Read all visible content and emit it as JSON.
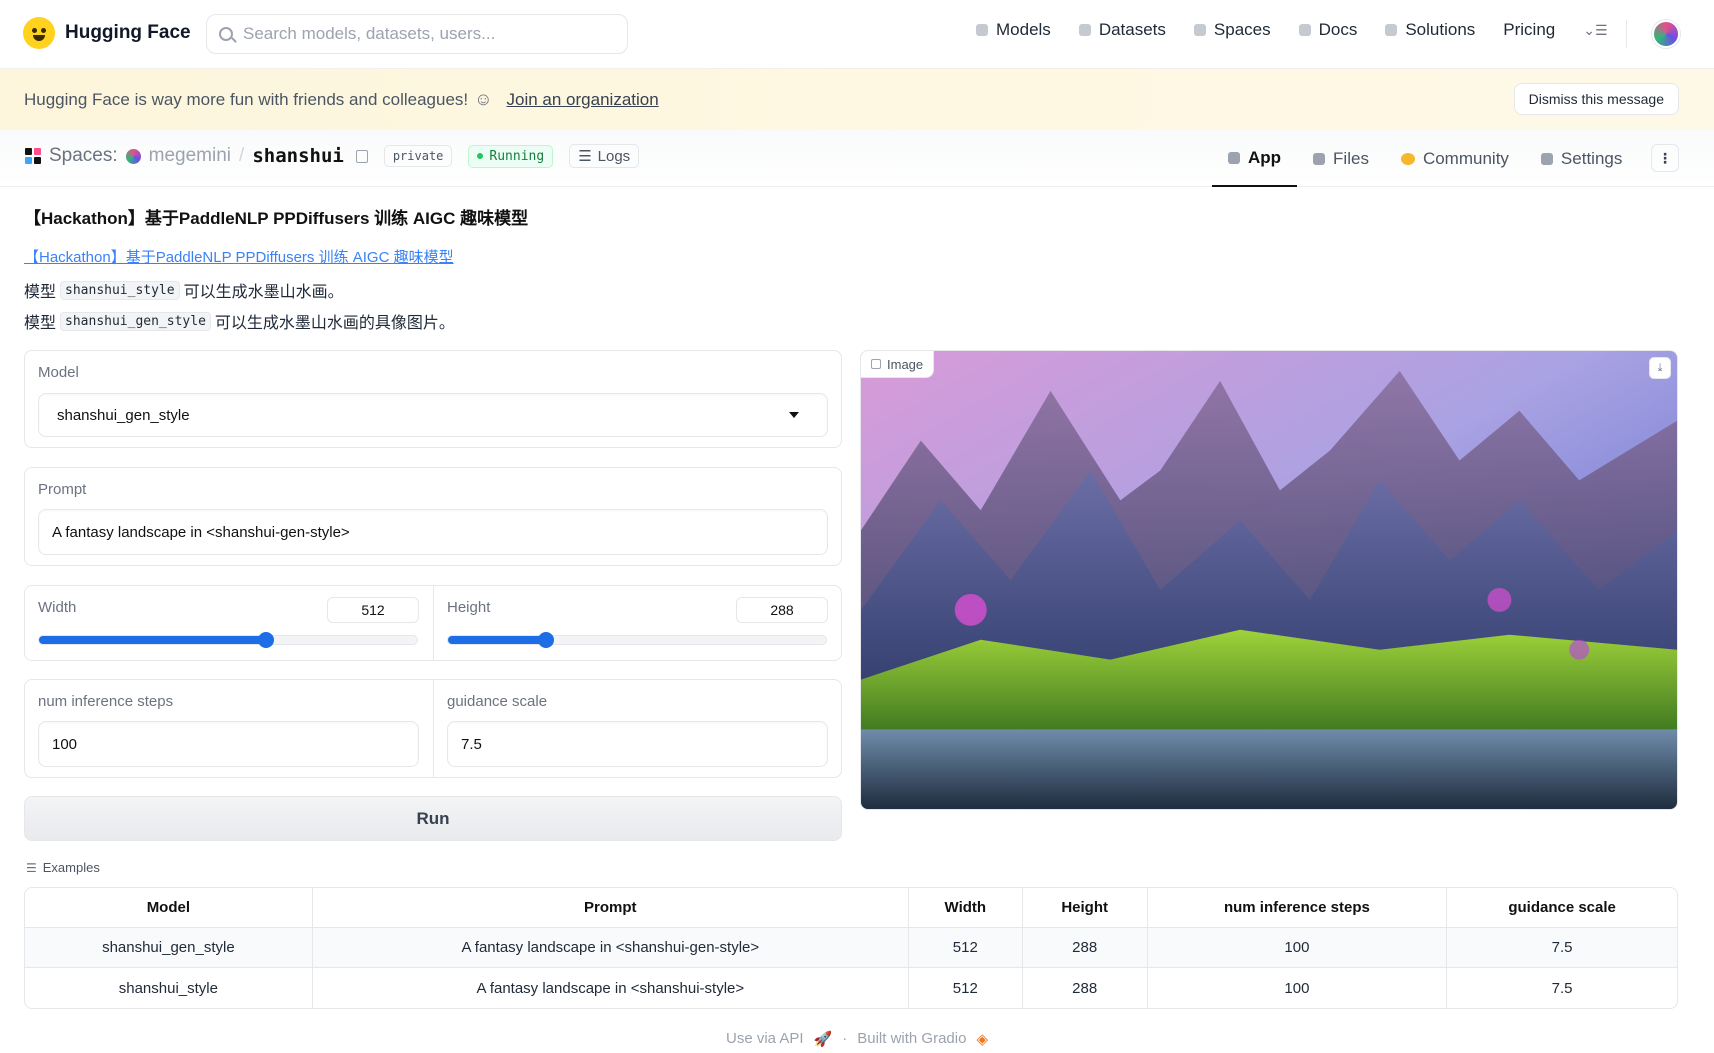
{
  "brand": {
    "name": "Hugging Face"
  },
  "search": {
    "placeholder": "Search models, datasets, users..."
  },
  "nav": {
    "items": [
      {
        "label": "Models",
        "icon": "cube-icon"
      },
      {
        "label": "Datasets",
        "icon": "database-icon"
      },
      {
        "label": "Spaces",
        "icon": "grid-icon"
      },
      {
        "label": "Docs",
        "icon": "book-icon"
      },
      {
        "label": "Solutions",
        "icon": "briefcase-icon"
      },
      {
        "label": "Pricing"
      }
    ]
  },
  "banner": {
    "text": "Hugging Face is way more fun with friends and colleagues!",
    "icon": "hugging-icon",
    "link": "Join an organization",
    "dismiss": "Dismiss this message"
  },
  "space": {
    "section": "Spaces:",
    "owner": "megemini",
    "separator": "/",
    "repo": "shanshui",
    "visibility": "private",
    "status": "Running",
    "logs": "Logs",
    "tabs": [
      "App",
      "Files",
      "Community",
      "Settings"
    ]
  },
  "app": {
    "title": "【Hackathon】基于PaddleNLP PPDiffusers 训练 AIGC 趣味模型",
    "link": "【Hackathon】基于PaddleNLP PPDiffusers 训练 AIGC 趣味模型",
    "desc1": {
      "pre": "模型",
      "code": "shanshui_style",
      "post": "可以生成水墨山水画。"
    },
    "desc2": {
      "pre": "模型",
      "code": "shanshui_gen_style",
      "post": "可以生成水墨山水画的具像图片。"
    }
  },
  "form": {
    "model": {
      "label": "Model",
      "value": "shanshui_gen_style"
    },
    "prompt": {
      "label": "Prompt",
      "value": "A fantasy landscape in <shanshui-gen-style>"
    },
    "width": {
      "label": "Width",
      "value": "512",
      "fraction": 0.6
    },
    "height": {
      "label": "Height",
      "value": "288",
      "fraction": 0.26
    },
    "steps": {
      "label": "num inference steps",
      "value": "100"
    },
    "guidance": {
      "label": "guidance scale",
      "value": "7.5"
    },
    "run": "Run"
  },
  "output": {
    "label": "Image"
  },
  "examples": {
    "title": "Examples",
    "columns": [
      "Model",
      "Prompt",
      "Width",
      "Height",
      "num inference steps",
      "guidance scale"
    ],
    "rows": [
      [
        "shanshui_gen_style",
        "A fantasy landscape in <shanshui-gen-style>",
        "512",
        "288",
        "100",
        "7.5"
      ],
      [
        "shanshui_style",
        "A fantasy landscape in <shanshui-style>",
        "512",
        "288",
        "100",
        "7.5"
      ]
    ]
  },
  "footer": {
    "api": "Use via API",
    "built": "Built with Gradio",
    "dot": "·"
  },
  "colors": {
    "accent": "#1d6de6",
    "brand": "#FFD21E",
    "running": "#22c55e"
  }
}
